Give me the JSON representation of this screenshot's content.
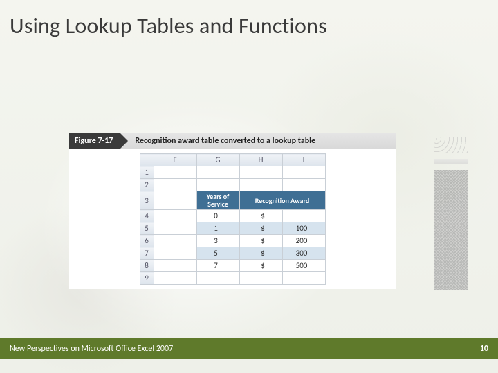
{
  "title": "Using Lookup Tables and Functions",
  "figure": {
    "label": "Figure 7-17",
    "caption": "Recognition award table converted to a lookup table"
  },
  "sheet": {
    "cols": [
      "F",
      "G",
      "H",
      "I"
    ],
    "rows": [
      "1",
      "2",
      "3",
      "4",
      "5",
      "6",
      "7",
      "8",
      "9"
    ],
    "label_years": "Years of Service",
    "label_award": "Recognition Award",
    "data": [
      {
        "years": "0",
        "cur": "$",
        "award": "-"
      },
      {
        "years": "1",
        "cur": "$",
        "award": "100"
      },
      {
        "years": "3",
        "cur": "$",
        "award": "200"
      },
      {
        "years": "5",
        "cur": "$",
        "award": "300"
      },
      {
        "years": "7",
        "cur": "$",
        "award": "500"
      }
    ]
  },
  "footer": {
    "left": "New Perspectives on Microsoft Office Excel 2007",
    "page": "10"
  }
}
